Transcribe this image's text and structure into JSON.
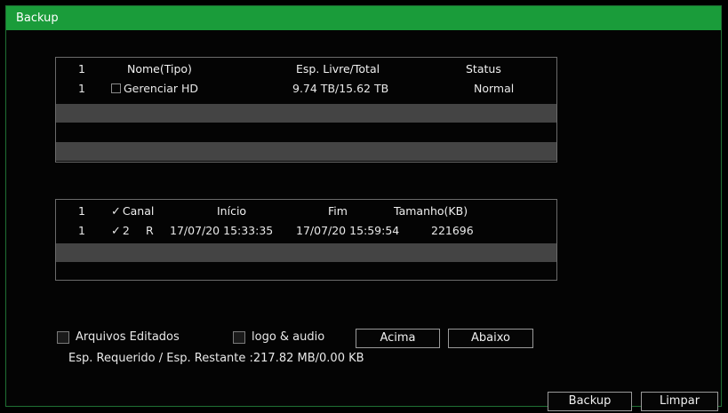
{
  "window": {
    "title": "Backup"
  },
  "devices_table": {
    "headers": {
      "index": "1",
      "name": "Nome(Tipo)",
      "space": "Esp. Livre/Total",
      "status": "Status"
    },
    "rows": [
      {
        "index": "1",
        "name": "Gerenciar HD",
        "space": "9.74 TB/15.62 TB",
        "status": "Normal"
      }
    ]
  },
  "files_table": {
    "headers": {
      "index": "1",
      "channel": "Canal",
      "start": "Início",
      "end": "Fim",
      "size": "Tamanho(KB)"
    },
    "rows": [
      {
        "index": "1",
        "channel": "2",
        "type": "R",
        "start": "17/07/20 15:33:35",
        "end": "17/07/20 15:59:54",
        "size": "221696"
      }
    ]
  },
  "options": {
    "edited_files_label": "Arquivos Editados",
    "logo_audio_label": "logo & audio",
    "up_button": "Acima",
    "down_button": "Abaixo"
  },
  "space_info": "Esp. Requerido / Esp. Restante :217.82 MB/0.00 KB",
  "footer": {
    "backup_button": "Backup",
    "clear_button": "Limpar"
  },
  "colors": {
    "titlebar": "#1a9c3a",
    "shaded_row": "#444444",
    "background": "#040404"
  }
}
